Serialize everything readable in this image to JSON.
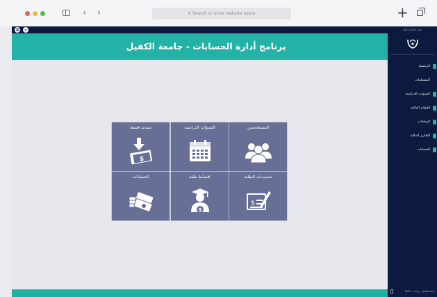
{
  "browser": {
    "url_placeholder": "Search or enter website name",
    "back": "‹",
    "forward": "›",
    "new_tab": "+"
  },
  "app": {
    "title": "برنامج أدارة الحسابات - جامعة الكفيل",
    "accent_color": "#23b2a6",
    "tile_color": "#676f96",
    "sidebar_color": "#0b1a3e"
  },
  "tiles": [
    {
      "label": "تسديد قسط",
      "icon": "money-download-icon"
    },
    {
      "label": "السنوات الدراسية",
      "icon": "calendar-icon"
    },
    {
      "label": "المستخدمين",
      "icon": "users-icon"
    },
    {
      "label": "الحسابات",
      "icon": "cash-stack-icon"
    },
    {
      "label": "اقساط طلبة",
      "icon": "student-fees-icon"
    },
    {
      "label": "تسديدات الطلبة",
      "icon": "payment-form-icon"
    }
  ],
  "sidebar": {
    "top_text": "2021-2022 ادارة",
    "items": [
      {
        "label": "الرئيسية",
        "icon": "home-icon"
      },
      {
        "label": "المستلمات",
        "icon": "receipts-icon"
      },
      {
        "label": "السنوات الدراسية",
        "icon": "calendar-icon"
      },
      {
        "label": "القوائم المالية",
        "icon": "lists-icon"
      },
      {
        "label": "المبادلات",
        "icon": "exchange-icon"
      },
      {
        "label": "التقارير المالية",
        "icon": "reports-icon"
      },
      {
        "label": "الحسابات",
        "icon": "accounts-icon"
      }
    ],
    "footer": "جامعة الكفيل - برمجة ... 2021"
  }
}
